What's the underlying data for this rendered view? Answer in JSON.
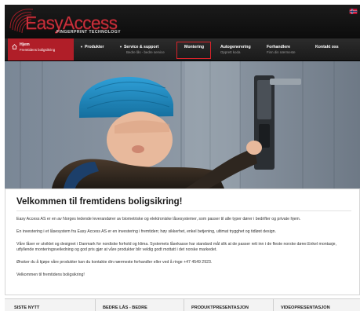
{
  "brand": {
    "name": "EasyAccess",
    "tagline": "FINGERPRINT TECHNOLOGY",
    "accent": "#c7303b"
  },
  "nav": {
    "items": [
      {
        "title": "Hjem",
        "subtitle": "Fremtidens boligsikring",
        "active": true,
        "icon": "home-icon"
      },
      {
        "title": "Produkter",
        "subtitle": "",
        "dropdown": true
      },
      {
        "title": "Service & support",
        "subtitle": "Bedre lås - bedre service",
        "dropdown": true
      },
      {
        "title": "Montering",
        "subtitle": "",
        "highlighted": true
      },
      {
        "title": "Autogenerering",
        "subtitle": "Opprett koda"
      },
      {
        "title": "Forhandlere",
        "subtitle": "Finn din nærmeste"
      },
      {
        "title": "Kontakt oss",
        "subtitle": ""
      }
    ],
    "active_color": "#b01e28",
    "highlight_color": "#d8232a"
  },
  "welcome": {
    "title": "Velkommen til fremtidens boligsikring!",
    "paragraphs": [
      "Easy Access AS er en av Norges ledende leverandører av biometriske og elektroniske låsesystemer, som passer til alle typer dører i bedrifter og private hjem.",
      "En investering i et låsesystem fra Easy Access AS er en investering i fremtiden; høy sikkerhet, enkel betjening, ultimat trygghet og tidløst design.",
      "Våre låser er utviklet og designet i Danmark for nordiske forhold og klima. Systemets låsekasse har standard mål slik at de passer rett inn i de fleste norske dører.Enkel montasje, utfyllende monteringsveiledning og god pris gjør at våre produkter blir veldig godt mottatt i det norske markedet.",
      "Ønsker du å kjøpe våre produkter kan du kontakte din nærmeste forhandler eller ved å ringe +47 4549 2923.",
      "Velkommen til fremtidens boligsikring!"
    ]
  },
  "bottom_columns": [
    "SISTE NYTT",
    "BEDRE LÅS - BEDRE",
    "PRODUKTPRESENTASJON",
    "VIDEOPRESENTASJON"
  ]
}
